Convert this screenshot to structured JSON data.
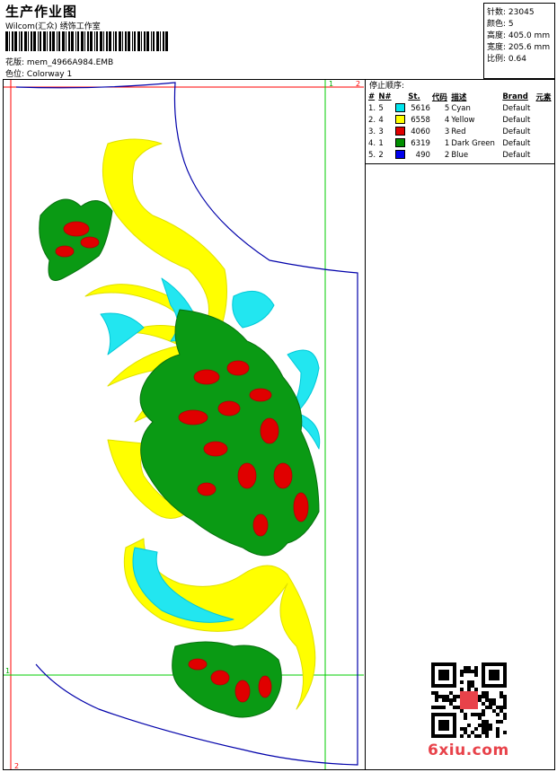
{
  "header": {
    "title": "生产作业图",
    "studio": "Wilcom(汇众) 绣饰工作室",
    "design_label": "花版:",
    "design_value": "mem_4966A984.EMB",
    "colorway_label": "色位:",
    "colorway_value": "Colorway 1"
  },
  "specs": [
    {
      "label": "针数:",
      "value": "23045"
    },
    {
      "label": "颜色:",
      "value": "5"
    },
    {
      "label": "高度:",
      "value": "405.0 mm"
    },
    {
      "label": "宽度:",
      "value": "205.6 mm"
    },
    {
      "label": "比例:",
      "value": "0.64"
    }
  ],
  "stop_sequence": {
    "title": "停止顺序:",
    "headers": {
      "seq": "#",
      "no": "N#",
      "stitches": "St.",
      "code": "代码",
      "desc": "描述",
      "brand": "Brand",
      "element": "元素"
    },
    "rows": [
      {
        "seq": "1.",
        "no": "5",
        "color": "#00e5ee",
        "stitches": "5616",
        "code": "5",
        "desc": "Cyan",
        "brand": "Default"
      },
      {
        "seq": "2.",
        "no": "4",
        "color": "#ffff00",
        "stitches": "6558",
        "code": "4",
        "desc": "Yellow",
        "brand": "Default"
      },
      {
        "seq": "3.",
        "no": "3",
        "color": "#e00000",
        "stitches": "4060",
        "code": "3",
        "desc": "Red",
        "brand": "Default"
      },
      {
        "seq": "4.",
        "no": "1",
        "color": "#008f00",
        "stitches": "6319",
        "code": "1",
        "desc": "Dark Green",
        "brand": "Default"
      },
      {
        "seq": "5.",
        "no": "2",
        "color": "#0000ee",
        "stitches": "490",
        "code": "2",
        "desc": "Blue",
        "brand": "Default"
      }
    ]
  },
  "guides": {
    "top_left": "1",
    "top_right": "2",
    "side_mark": "1",
    "bottom_mark": "2"
  },
  "watermark": {
    "logo_text": "6xiu.com",
    "qr_icon": "qr-code-icon"
  },
  "colors": {
    "guide_red": "#ff0000",
    "guide_green": "#00cc00",
    "outline_blue": "#0000aa"
  }
}
